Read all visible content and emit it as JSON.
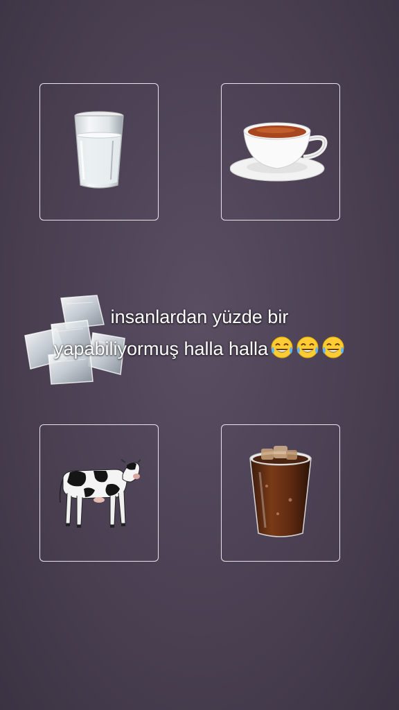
{
  "cards": {
    "top_left": {
      "icon": "water-glass-icon"
    },
    "top_right": {
      "icon": "tea-cup-icon"
    },
    "bottom_left": {
      "icon": "cow-icon"
    },
    "bottom_right": {
      "icon": "iced-cola-icon"
    }
  },
  "decor": {
    "icon": "ice-cubes-icon"
  },
  "caption": {
    "line1": "insanlardan yüzde bir",
    "line2": "yapabiliyormuş halla halla",
    "emoji": "laughing-tears-emoji"
  },
  "colors": {
    "background": "#4a4052",
    "card_border": "#e8e4ec",
    "text": "#ffffff"
  }
}
